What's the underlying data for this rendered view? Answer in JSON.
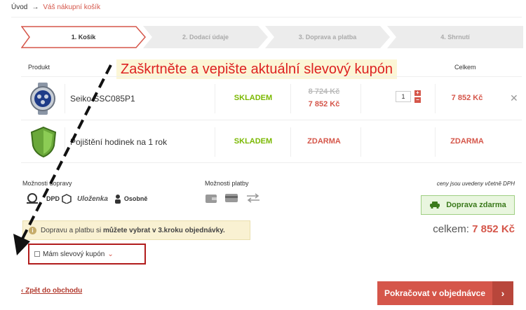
{
  "breadcrumb": {
    "home": "Úvod",
    "separator": "→",
    "current": "Váš nákupní košík"
  },
  "steps": [
    "1. Košík",
    "2. Dodací údaje",
    "3. Doprava a platba",
    "4. Shrnutí"
  ],
  "table_header": {
    "product": "Produkt",
    "total": "Celkem"
  },
  "annotation": "Zaškrtněte a vepište aktuální slevový kupón",
  "items": [
    {
      "name": "Seiko SSC085P1",
      "stock": "SKLADEM",
      "old_price": "8 724 Kč",
      "price": "7 852 Kč",
      "quantity": "1",
      "total": "7 852 Kč",
      "remove": "✕"
    },
    {
      "name": "Pojištění hodinek na 1 rok",
      "stock": "SKLADEM",
      "price": "ZDARMA",
      "total": "ZDARMA"
    }
  ],
  "shipping": {
    "label": "Možnosti dopravy",
    "options": [
      "Česká pošta",
      "DPD",
      "Uloženka",
      "Osobně"
    ]
  },
  "payment": {
    "label": "Možnosti platby"
  },
  "vat_note": "ceny jsou uvedeny včetně DPH",
  "free_shipping": "Doprava zdarma",
  "grand_total": {
    "label": "celkem:",
    "value": "7 852 Kč"
  },
  "info_box": {
    "text": "Dopravu a platbu si ",
    "bold": "můžete vybrat v 3.kroku objednávky."
  },
  "coupon": {
    "label": "Mám slevový kupón",
    "chevron": "⌄"
  },
  "back_link": "Zpět do obchodu",
  "continue_button": "Pokračovat v objednávce",
  "colors": {
    "accent": "#d5564a",
    "in_stock": "#7ab800",
    "annotation": "#dd2222",
    "coupon_border": "#b11c1c"
  }
}
